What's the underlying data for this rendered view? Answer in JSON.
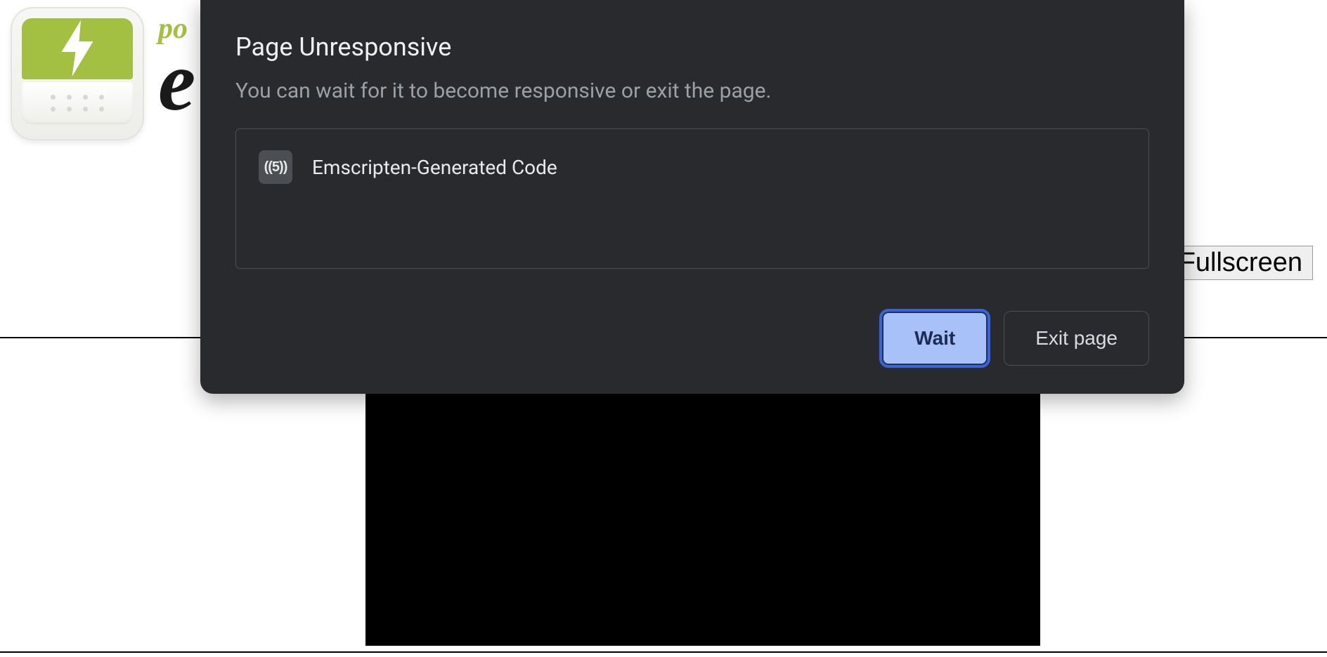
{
  "brand": {
    "tagline": "po",
    "name_fragment": "e"
  },
  "page": {
    "fullscreen_label": "Fullscreen"
  },
  "dialog": {
    "title": "Page Unresponsive",
    "subtitle": "You can wait for it to become responsive or exit the page.",
    "process": {
      "favicon_text": "((5))",
      "name": "Emscripten-Generated Code"
    },
    "buttons": {
      "wait": "Wait",
      "exit": "Exit page"
    }
  }
}
